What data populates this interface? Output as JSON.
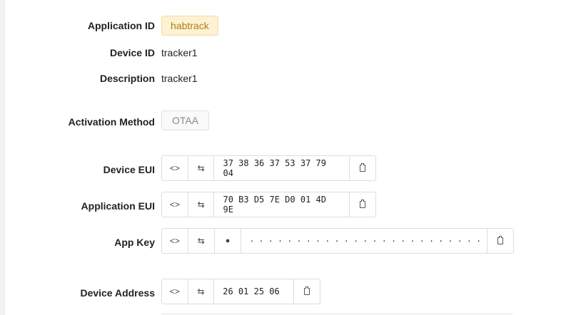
{
  "device": {
    "application_id": {
      "label": "Application ID",
      "value": "habtrack"
    },
    "device_id": {
      "label": "Device ID",
      "value": "tracker1"
    },
    "description": {
      "label": "Description",
      "value": "tracker1"
    },
    "activation_method": {
      "label": "Activation Method",
      "value": "OTAA"
    },
    "device_eui": {
      "label": "Device EUI",
      "value": "37 38 36 37 53 37 79 04"
    },
    "application_eui": {
      "label": "Application EUI",
      "value": "70 B3 D5 7E D0 01 4D 9E"
    },
    "app_key": {
      "label": "App Key",
      "value": "· · · · · · · · · · · · · · · · · · · · · · · · · · · · · · · ·"
    },
    "device_address": {
      "label": "Device Address",
      "value": "26 01 25 06"
    }
  },
  "icons": {
    "format_toggle": "<>",
    "byte_order": "⇆",
    "reveal": "eye-icon",
    "copy": "clipboard-icon"
  }
}
